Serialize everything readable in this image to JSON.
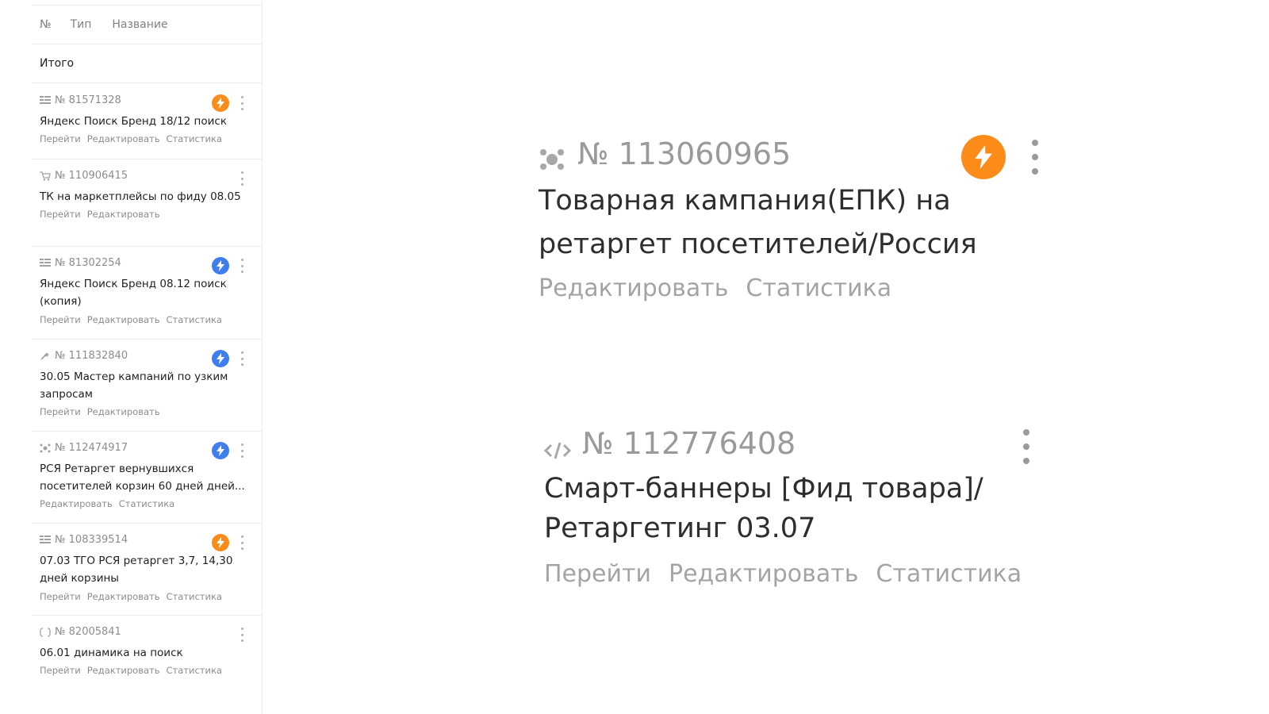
{
  "table": {
    "col_num": "№",
    "col_type": "Тип",
    "col_name": "Название",
    "total_label": "Итого"
  },
  "colors": {
    "orange_badge": "#fb8c1a",
    "blue_badge": "#3f7ef0"
  },
  "campaigns": [
    {
      "id": "№ 81571328",
      "type_icon": "text-ads-icon",
      "name": "Яндекс Поиск Бренд 18/12 поиск",
      "badge": "orange",
      "links": [
        "Перейти",
        "Редактировать",
        "Статистика"
      ]
    },
    {
      "id": "№ 110906415",
      "type_icon": "cart-icon",
      "name": "ТК на маркетплейсы по фиду 08.05",
      "badge": "",
      "links": [
        "Перейти",
        "Редактировать"
      ]
    },
    {
      "id": "№ 81302254",
      "type_icon": "text-ads-icon",
      "name": "Яндекс Поиск Бренд 08.12 поиск (копия)",
      "badge": "blue",
      "links": [
        "Перейти",
        "Редактировать",
        "Статистика"
      ]
    },
    {
      "id": "№ 111832840",
      "type_icon": "master-icon",
      "name": "30.05 Мастер кампаний по узким запросам",
      "badge": "blue",
      "links": [
        "Перейти",
        "Редактировать"
      ]
    },
    {
      "id": "№ 112474917",
      "type_icon": "network-icon",
      "name": "РСЯ Ретаргет вернувшихся посетителей корзин 60 дней дней...",
      "badge": "blue",
      "links": [
        "Редактировать",
        "Статистика"
      ]
    },
    {
      "id": "№ 108339514",
      "type_icon": "text-ads-icon",
      "name": "07.03 ТГО РСЯ ретаргет 3,7, 14,30 дней корзины",
      "badge": "orange",
      "links": [
        "Перейти",
        "Редактировать",
        "Статистика"
      ]
    },
    {
      "id": "№ 82005841",
      "type_icon": "dynamic-icon",
      "name": "06.01 динамика на поиск",
      "badge": "",
      "links": [
        "Перейти",
        "Редактировать",
        "Статистика"
      ]
    }
  ],
  "zoom_cards": [
    {
      "id": "№ 113060965",
      "type_icon": "network-icon",
      "name_line1": "Товарная кампания(ЕПК) на",
      "name_line2": "ретаргет посетителей/Россия",
      "badge": "orange",
      "links": [
        "Редактировать",
        "Статистика"
      ]
    },
    {
      "id": "№ 112776408",
      "type_icon": "code-icon",
      "name_line1": "Смарт-баннеры [Фид товара]/",
      "name_line2": "Ретаргетинг 03.07",
      "badge": "",
      "links": [
        "Перейти",
        "Редактировать",
        "Статистика"
      ]
    }
  ]
}
